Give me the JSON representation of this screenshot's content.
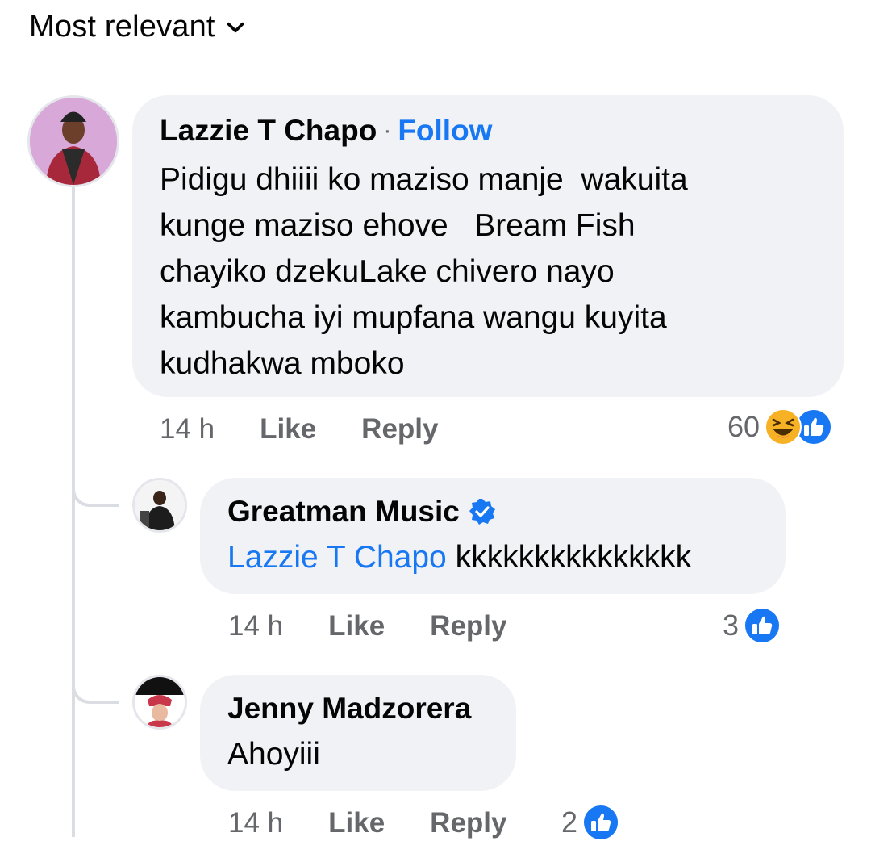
{
  "sort": {
    "label": "Most relevant"
  },
  "comments": [
    {
      "author": "Lazzie T Chapo",
      "separator": "·",
      "follow_label": "Follow",
      "text": "Pidigu dhiiii ko maziso manje  wakuita\nkunge maziso ehove   Bream Fish\nchayiko dzekuLake chivero nayo\nkambucha iyi mupfana wangu kuyita\nkudhakwa mboko",
      "time": "14 h",
      "like_label": "Like",
      "reply_label": "Reply",
      "reaction_count": "60",
      "reactions": [
        "haha-icon",
        "like-icon"
      ]
    },
    {
      "author": "Greatman Music",
      "verified": true,
      "mention": "Lazzie T Chapo",
      "text": " kkkkkkkkkkkkkkk",
      "time": "14 h",
      "like_label": "Like",
      "reply_label": "Reply",
      "reaction_count": "3",
      "reactions": [
        "like-icon"
      ]
    },
    {
      "author": "Jenny Madzorera",
      "text": "Ahoyiii",
      "time": "14 h",
      "like_label": "Like",
      "reply_label": "Reply",
      "reaction_count": "2",
      "reactions": [
        "like-icon"
      ]
    }
  ],
  "colors": {
    "link": "#1877f2",
    "bubble": "#f0f2f5",
    "meta": "#65676b",
    "like": "#1877f2",
    "haha": "#f7b125"
  }
}
